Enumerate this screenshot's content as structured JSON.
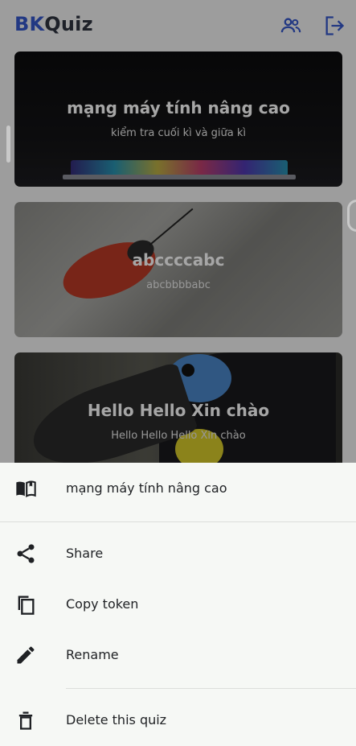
{
  "app": {
    "logo_part1": "BK",
    "logo_part2": "Quiz",
    "accent_color": "#3557c9",
    "header_icons": [
      "group-icon",
      "logout-icon"
    ]
  },
  "quizzes": [
    {
      "title": "mạng máy tính nâng cao",
      "subtitle": "kiểm tra cuối kì và giữa kì",
      "image": "laptop-keyboard"
    },
    {
      "title": "abccccabc",
      "subtitle": "abcbbbbabc",
      "image": "red-beetle"
    },
    {
      "title": "Hello Hello Xin chào",
      "subtitle": "Hello Hello Hello Xin chào",
      "image": "toucan"
    }
  ],
  "sheet": {
    "header": {
      "icon": "book-icon",
      "label": "mạng máy tính nâng cao"
    },
    "items": [
      {
        "icon": "share-icon",
        "label": "Share"
      },
      {
        "icon": "copy-icon",
        "label": "Copy token"
      },
      {
        "icon": "edit-icon",
        "label": "Rename"
      },
      {
        "icon": "delete-icon",
        "label": "Delete this quiz"
      }
    ]
  }
}
